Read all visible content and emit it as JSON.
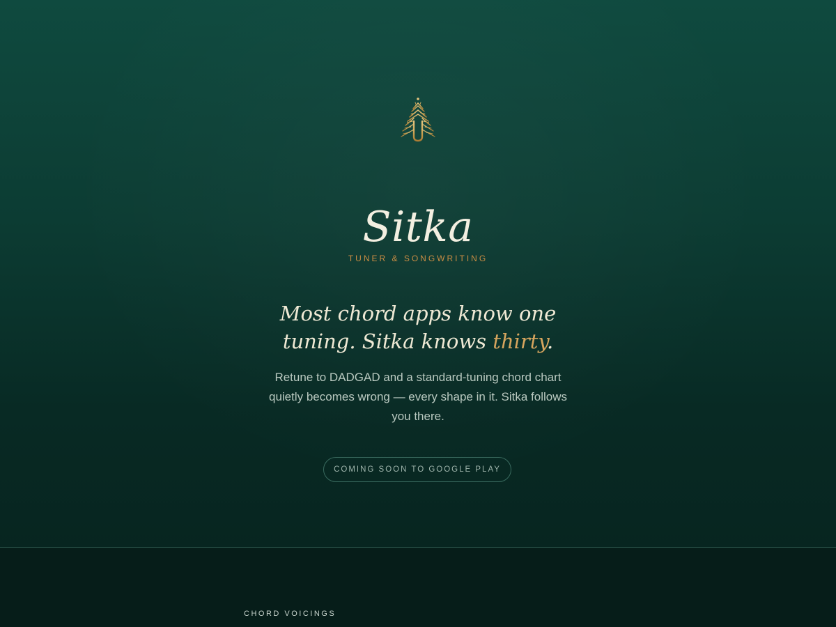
{
  "hero": {
    "app_name": "Sitka",
    "tagline": "TUNER & SONGWRITING",
    "headline_part1": "Most chord apps know one tuning. Sitka knows ",
    "headline_accent": "thirty",
    "headline_end": ".",
    "description": "Retune to DADGAD and a standard-tuning chord chart quietly becomes wrong — every shape in it. Sitka follows you there.",
    "cta_label": "COMING SOON TO GOOGLE PLAY"
  },
  "next_section": {
    "label": "CHORD VOICINGS"
  },
  "colors": {
    "background": "#0c3c33",
    "accent": "#d6a45c",
    "tagline": "#c98a3f",
    "text": "#efe9d4"
  },
  "icons": {
    "logo": "spruce-tree-tuning-fork-icon"
  }
}
